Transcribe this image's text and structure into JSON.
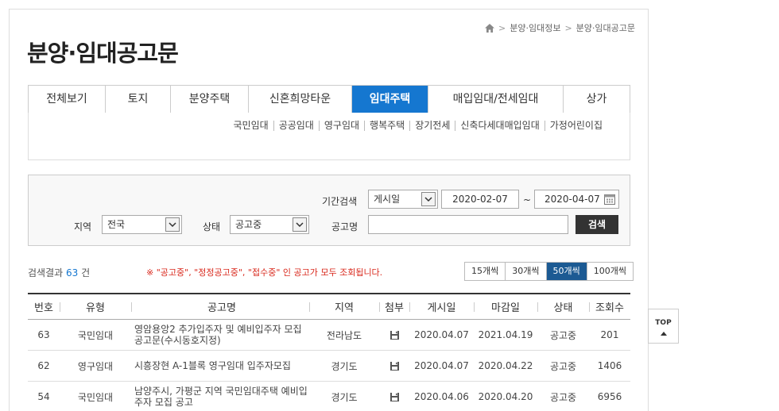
{
  "breadcrumb": {
    "items": [
      "분양·임대정보",
      "분양·임대공고문"
    ]
  },
  "page_title": "분양·임대공고문",
  "tabs": [
    {
      "label": "전체보기"
    },
    {
      "label": "토지"
    },
    {
      "label": "분양주택"
    },
    {
      "label": "신혼희망타운"
    },
    {
      "label": "임대주택",
      "active": true
    },
    {
      "label": "매입임대/전세임대"
    },
    {
      "label": "상가"
    }
  ],
  "subtabs": [
    "국민임대",
    "공공임대",
    "영구임대",
    "행복주택",
    "장기전세",
    "신축다세대매입임대",
    "가정어린이집"
  ],
  "search": {
    "period_label": "기간검색",
    "period_select": "게시일",
    "date_from": "2020-02-07",
    "tilde": "~",
    "date_to": "2020-04-07",
    "region_label": "지역",
    "region_select": "전국",
    "status_label": "상태",
    "status_select": "공고중",
    "name_label": "공고명",
    "name_value": "",
    "button": "검색"
  },
  "results": {
    "prefix": "검색결과",
    "count": "63",
    "suffix": "건",
    "notice": "※ \"공고중\", \"정정공고중\", \"접수중\" 인 공고가 모두 조회됩니다."
  },
  "perpage": [
    {
      "label": "15개씩"
    },
    {
      "label": "30개씩"
    },
    {
      "label": "50개씩",
      "active": true
    },
    {
      "label": "100개씩"
    }
  ],
  "table": {
    "headers": [
      "번호",
      "유형",
      "공고명",
      "지역",
      "첨부",
      "게시일",
      "마감일",
      "상태",
      "조회수"
    ],
    "rows": [
      {
        "no": "63",
        "type": "국민임대",
        "title": "영암용앙2 추가입주자 및 예비입주자 모집 공고문(수시동호지정)",
        "region": "전라남도",
        "posted": "2020.04.07",
        "deadline": "2021.04.19",
        "status": "공고중",
        "views": "201"
      },
      {
        "no": "62",
        "type": "영구임대",
        "title": "시흥장현 A-1블록 영구임대 입주자모집",
        "region": "경기도",
        "posted": "2020.04.07",
        "deadline": "2020.04.22",
        "status": "공고중",
        "views": "1406"
      },
      {
        "no": "54",
        "type": "국민임대",
        "title": "남양주시, 가평군 지역 국민임대주택 예비입주자 모집 공고",
        "region": "경기도",
        "posted": "2020.04.06",
        "deadline": "2020.04.20",
        "status": "공고중",
        "views": "6956"
      }
    ]
  },
  "top_button": "TOP",
  "colors": {
    "accent": "#1577d0",
    "active_perpage": "#1c5a93",
    "notice": "#d9281c",
    "search_button": "#333333"
  }
}
